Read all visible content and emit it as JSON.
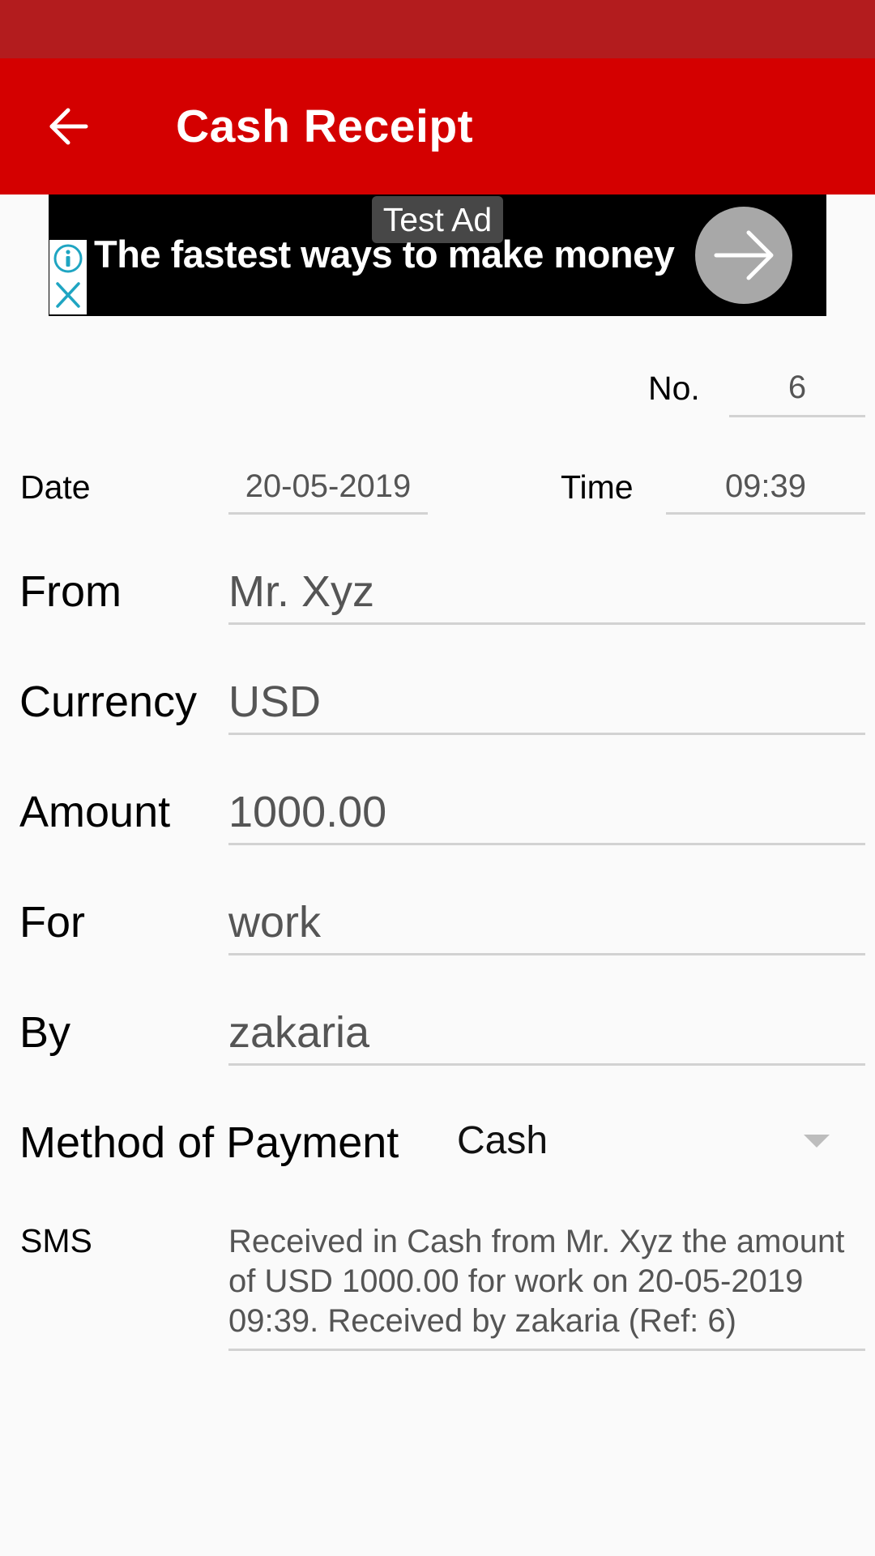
{
  "app_bar": {
    "title": "Cash Receipt",
    "back_icon": "arrow-back-icon",
    "colors": {
      "status_bar": "#b31c1e",
      "app_bar": "#d40000"
    }
  },
  "ad": {
    "label": "Test Ad",
    "headline": "The fastest ways to make money",
    "info_icon": "info-icon",
    "close_icon": "close-icon",
    "cta_icon": "arrow-forward-icon"
  },
  "form": {
    "number": {
      "label": "No.",
      "value": "6"
    },
    "date": {
      "label": "Date",
      "value": "20-05-2019"
    },
    "time": {
      "label": "Time",
      "value": "09:39"
    },
    "from": {
      "label": "From",
      "value": "Mr. Xyz"
    },
    "currency": {
      "label": "Currency",
      "value": "USD"
    },
    "amount": {
      "label": "Amount",
      "value": "1000.00"
    },
    "for": {
      "label": "For",
      "value": "work"
    },
    "by": {
      "label": "By",
      "value": "zakaria"
    },
    "method": {
      "label": "Method of Payment",
      "value": "Cash"
    },
    "sms": {
      "label": "SMS",
      "value": "Received in Cash from Mr. Xyz the amount\nof USD 1000.00 for work on 20-05-2019\n09:39. Received by zakaria (Ref: 6)"
    }
  }
}
